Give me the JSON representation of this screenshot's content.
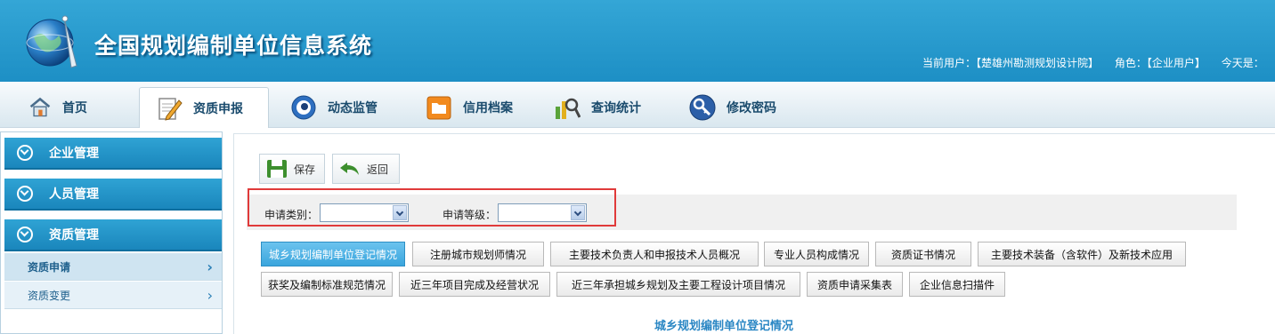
{
  "header": {
    "title": "全国规划编制单位信息系统",
    "current_user": "当前用户：【楚雄州勘测规划设计院】",
    "role": "角色：【企业用户】",
    "today": "今天是："
  },
  "nav": [
    {
      "label": "首页",
      "icon": "home-icon"
    },
    {
      "label": "资质申报",
      "icon": "edit-icon"
    },
    {
      "label": "动态监管",
      "icon": "monitor-icon"
    },
    {
      "label": "信用档案",
      "icon": "folder-icon"
    },
    {
      "label": "查询统计",
      "icon": "search-stats-icon"
    },
    {
      "label": "修改密码",
      "icon": "key-icon"
    }
  ],
  "sidebar": {
    "groups": [
      {
        "label": "企业管理"
      },
      {
        "label": "人员管理"
      },
      {
        "label": "资质管理"
      }
    ],
    "items": [
      {
        "label": "资质申请"
      },
      {
        "label": "资质变更"
      }
    ]
  },
  "toolbar": {
    "save": "保存",
    "back": "返回"
  },
  "filters": {
    "category_label": "申请类别：",
    "category_value": "",
    "grade_label": "申请等级：",
    "grade_value": ""
  },
  "tabs": [
    "城乡规划编制单位登记情况",
    "注册城市规划师情况",
    "主要技术负责人和申报技术人员概况",
    "专业人员构成情况",
    "资质证书情况",
    "主要技术装备（含软件）及新技术应用",
    "获奖及编制标准规范情况",
    "近三年项目完成及经营状况",
    "近三年承担城乡规划及主要工程设计项目情况",
    "资质申请采集表",
    "企业信息扫描件"
  ],
  "form_title": "城乡规划编制单位登记情况",
  "colors": {
    "header": "#1d8fc5",
    "accent": "#3aa5dd",
    "outline": "#e03a3a"
  }
}
